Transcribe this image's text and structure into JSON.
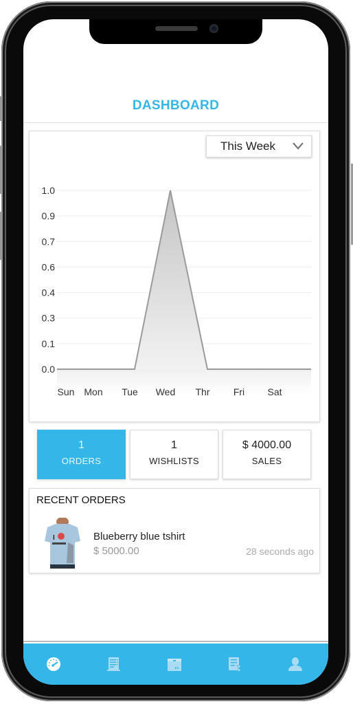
{
  "header": {
    "title": "DASHBOARD"
  },
  "filter": {
    "selected": "This Week"
  },
  "chart_data": {
    "type": "area",
    "title": "",
    "xlabel": "",
    "ylabel": "",
    "categories": [
      "Sun",
      "Mon",
      "Tue",
      "Wed",
      "Thr",
      "Fri",
      "Sat"
    ],
    "values": [
      0,
      0,
      0,
      1,
      0,
      0,
      0
    ],
    "y_ticks": [
      "0.0",
      "0.1",
      "0.3",
      "0.4",
      "0.6",
      "0.7",
      "0.9",
      "1.0"
    ],
    "ylim": [
      0,
      1
    ],
    "grid": true,
    "legend": "none",
    "colors": {
      "line": "#9a9a9a",
      "fill": "#cfcfcf"
    }
  },
  "stats": [
    {
      "value": "1",
      "label": "ORDERS",
      "active": true
    },
    {
      "value": "1",
      "label": "WISHLISTS",
      "active": false
    },
    {
      "value": "$ 4000.00",
      "label": "SALES",
      "active": false
    }
  ],
  "recent_orders": {
    "title": "RECENT ORDERS",
    "items": [
      {
        "name": "Blueberry blue tshirt",
        "price": "$ 5000.00",
        "time": "28 seconds ago",
        "image": "blue-tshirt-photo"
      }
    ]
  },
  "tabbar": {
    "items": [
      {
        "icon": "dashboard-gauge-icon",
        "active": true
      },
      {
        "icon": "orders-list-icon",
        "active": false
      },
      {
        "icon": "products-box-icon",
        "active": false
      },
      {
        "icon": "pending-orders-icon",
        "active": false
      },
      {
        "icon": "profile-user-icon",
        "active": false
      }
    ]
  },
  "colors": {
    "accent": "#35b6e8",
    "text": "#222222",
    "muted": "#999999"
  }
}
